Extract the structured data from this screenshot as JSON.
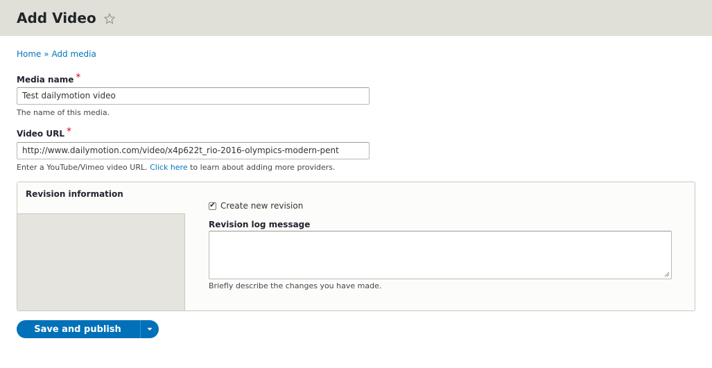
{
  "header": {
    "title": "Add Video",
    "star_icon": "star-outline-icon"
  },
  "breadcrumb": {
    "items": [
      "Home",
      "Add media"
    ],
    "separator": "»"
  },
  "fields": {
    "media_name": {
      "label": "Media name",
      "required_mark": "*",
      "value": "Test dailymotion video",
      "description": "The name of this media."
    },
    "video_url": {
      "label": "Video URL",
      "required_mark": "*",
      "value": "http://www.dailymotion.com/video/x4p622t_rio-2016-olympics-modern-pent",
      "description_before": "Enter a YouTube/Vimeo video URL.",
      "description_link": "Click here",
      "description_after": "to learn about adding more providers."
    }
  },
  "revision": {
    "tab_label": "Revision information",
    "checkbox_label": "Create new revision",
    "checkbox_checked": true,
    "checkbox_glyph": "✔",
    "log_label": "Revision log message",
    "log_value": "",
    "log_description": "Briefly describe the changes you have made."
  },
  "actions": {
    "save_label": "Save and publish",
    "dropdown_icon": "caret-down-icon"
  },
  "colors": {
    "header_bg": "#e0e0d8",
    "link": "#0074bd",
    "required": "#e1001d",
    "primary_button": "#0071b8"
  }
}
